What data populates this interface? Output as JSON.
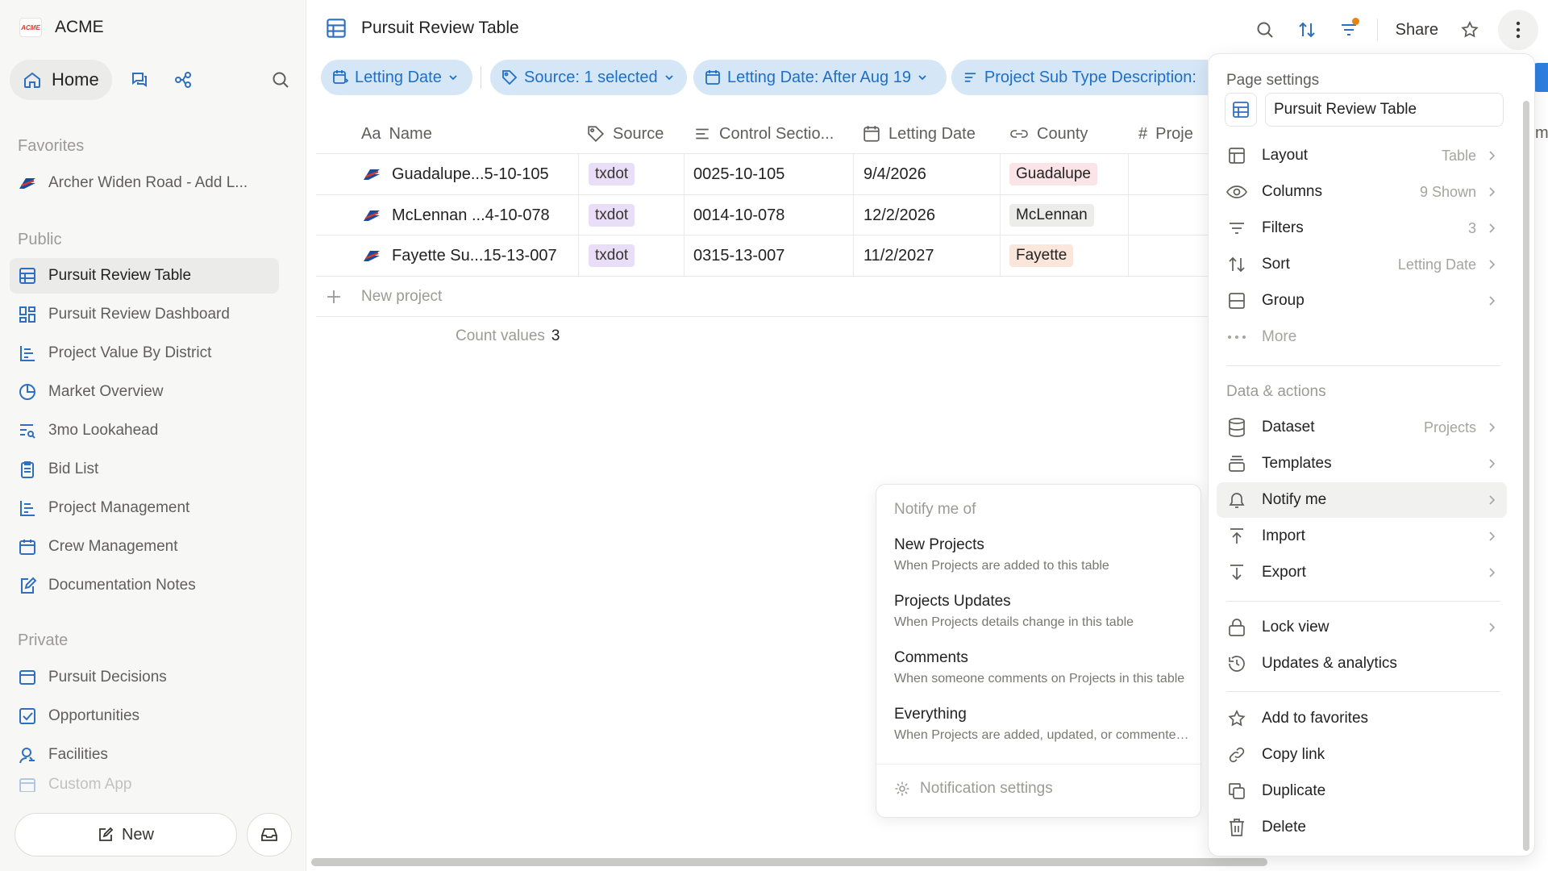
{
  "brand": {
    "logo_text": "ACME",
    "name": "ACME"
  },
  "sidebar": {
    "home_label": "Home",
    "sections": {
      "favorites": "Favorites",
      "public": "Public",
      "private": "Private"
    },
    "favorites": [
      {
        "label": "Archer Widen Road - Add L..."
      }
    ],
    "public": [
      {
        "label": "Pursuit Review Table",
        "icon": "table-icon",
        "active": true
      },
      {
        "label": "Pursuit Review Dashboard",
        "icon": "dashboard-icon"
      },
      {
        "label": "Project Value By District",
        "icon": "bar-chart-icon"
      },
      {
        "label": "Market Overview",
        "icon": "pie-chart-icon"
      },
      {
        "label": "3mo Lookahead",
        "icon": "list-search-icon"
      },
      {
        "label": "Bid List",
        "icon": "clipboard-icon"
      },
      {
        "label": "Project Management",
        "icon": "bar-chart-icon"
      },
      {
        "label": "Crew Management",
        "icon": "calendar-icon"
      },
      {
        "label": "Documentation Notes",
        "icon": "edit-note-icon"
      }
    ],
    "private": [
      {
        "label": "Pursuit Decisions",
        "icon": "window-icon"
      },
      {
        "label": "Opportunities",
        "icon": "checkbox-icon"
      },
      {
        "label": "Facilities",
        "icon": "person-search-icon"
      },
      {
        "label": "Custom App",
        "icon": "window-icon"
      }
    ],
    "new_label": "New"
  },
  "header": {
    "title": "Pursuit Review Table",
    "share_label": "Share"
  },
  "filters": [
    {
      "label": "Letting Date",
      "icon": "calendar-sort-icon"
    },
    {
      "label": "Source: 1 selected",
      "icon": "tag-icon"
    },
    {
      "label": "Letting Date: After Aug 19",
      "icon": "calendar-icon"
    },
    {
      "label": "Project Sub Type Description:",
      "icon": "text-icon"
    }
  ],
  "table": {
    "columns": [
      {
        "label": "Name",
        "icon_text": "Aa"
      },
      {
        "label": "Source",
        "icon": "tag-icon"
      },
      {
        "label": "Control Sectio...",
        "icon": "text-icon"
      },
      {
        "label": "Letting Date",
        "icon": "calendar-icon"
      },
      {
        "label": "County",
        "icon": "link-icon"
      },
      {
        "label": "Proje",
        "icon_text": "#"
      }
    ],
    "rows": [
      {
        "name": "Guadalupe...5-10-105",
        "source": "txdot",
        "control": "0025-10-105",
        "date": "9/4/2026",
        "county": "Guadalupe",
        "county_color": "#fbe4e7"
      },
      {
        "name": "McLennan ...4-10-078",
        "source": "txdot",
        "control": "0014-10-078",
        "date": "12/2/2026",
        "county": "McLennan",
        "county_color": "#ececea"
      },
      {
        "name": "Fayette Su...15-13-007",
        "source": "txdot",
        "control": "0315-13-007",
        "date": "11/2/2027",
        "county": "Fayette",
        "county_color": "#fbe6dc"
      }
    ],
    "new_row_label": "New project",
    "count_label": "Count values",
    "count_value": "3"
  },
  "notify": {
    "heading": "Notify me of",
    "items": [
      {
        "title": "New Projects",
        "desc": "When Projects are added to this table"
      },
      {
        "title": "Projects Updates",
        "desc": "When Projects details change in this table"
      },
      {
        "title": "Comments",
        "desc": "When someone comments on Projects in this table"
      },
      {
        "title": "Everything",
        "desc": "When Projects are added, updated, or commented on"
      }
    ],
    "settings_label": "Notification settings"
  },
  "panel": {
    "heading": "Page settings",
    "name_value": "Pursuit Review Table",
    "view_items": [
      {
        "label": "Layout",
        "value": "Table",
        "icon": "layout-icon"
      },
      {
        "label": "Columns",
        "value": "9 Shown",
        "icon": "eye-icon"
      },
      {
        "label": "Filters",
        "value": "3",
        "icon": "filter-icon"
      },
      {
        "label": "Sort",
        "value": "Letting Date",
        "icon": "sort-icon"
      },
      {
        "label": "Group",
        "value": "",
        "icon": "group-icon"
      },
      {
        "label": "More",
        "value": "",
        "icon": "more-dots-icon"
      }
    ],
    "data_heading": "Data & actions",
    "data_items": [
      {
        "label": "Dataset",
        "value": "Projects",
        "icon": "database-icon"
      },
      {
        "label": "Templates",
        "value": "",
        "icon": "templates-icon"
      },
      {
        "label": "Notify me",
        "value": "",
        "icon": "bell-icon"
      },
      {
        "label": "Import",
        "value": "",
        "icon": "import-icon"
      },
      {
        "label": "Export",
        "value": "",
        "icon": "export-icon"
      }
    ],
    "lock_items": [
      {
        "label": "Lock view",
        "icon": "lock-icon"
      },
      {
        "label": "Updates & analytics",
        "icon": "history-icon"
      }
    ],
    "action_items": [
      {
        "label": "Add to favorites",
        "icon": "star-icon"
      },
      {
        "label": "Copy link",
        "icon": "link-icon"
      },
      {
        "label": "Duplicate",
        "icon": "duplicate-icon"
      },
      {
        "label": "Delete",
        "icon": "trash-icon"
      }
    ],
    "peek_text": "m"
  }
}
